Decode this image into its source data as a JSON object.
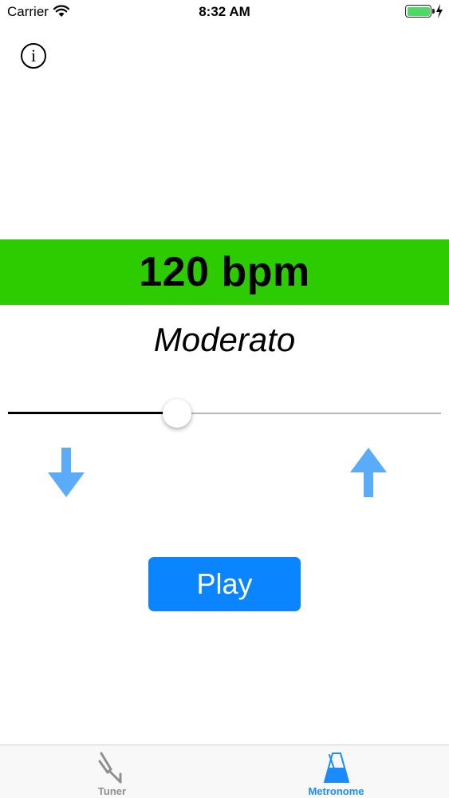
{
  "status_bar": {
    "carrier": "Carrier",
    "time": "8:32 AM",
    "battery_level": 1.0,
    "battery_color": "#4cd964",
    "icons": [
      "wifi-icon",
      "battery-icon",
      "charging-bolt-icon"
    ]
  },
  "info_button": {
    "icon": "info-icon",
    "glyph": "i"
  },
  "tempo": {
    "value_label": "120 bpm",
    "marking": "Moderato",
    "banner_color": "#2dcc00"
  },
  "slider": {
    "value_fraction": 0.39
  },
  "controls": {
    "decrease_icon": "arrow-down-icon",
    "increase_icon": "arrow-up-icon",
    "arrow_color": "#5aacf8",
    "play_label": "Play",
    "play_color": "#0a84ff"
  },
  "tab_bar": {
    "tabs": [
      {
        "label": "Tuner",
        "icon": "tuning-fork-icon",
        "selected": false
      },
      {
        "label": "Metronome",
        "icon": "metronome-icon",
        "selected": true
      }
    ],
    "selected_color": "#1a8cff",
    "unselected_color": "#8e8e93"
  }
}
